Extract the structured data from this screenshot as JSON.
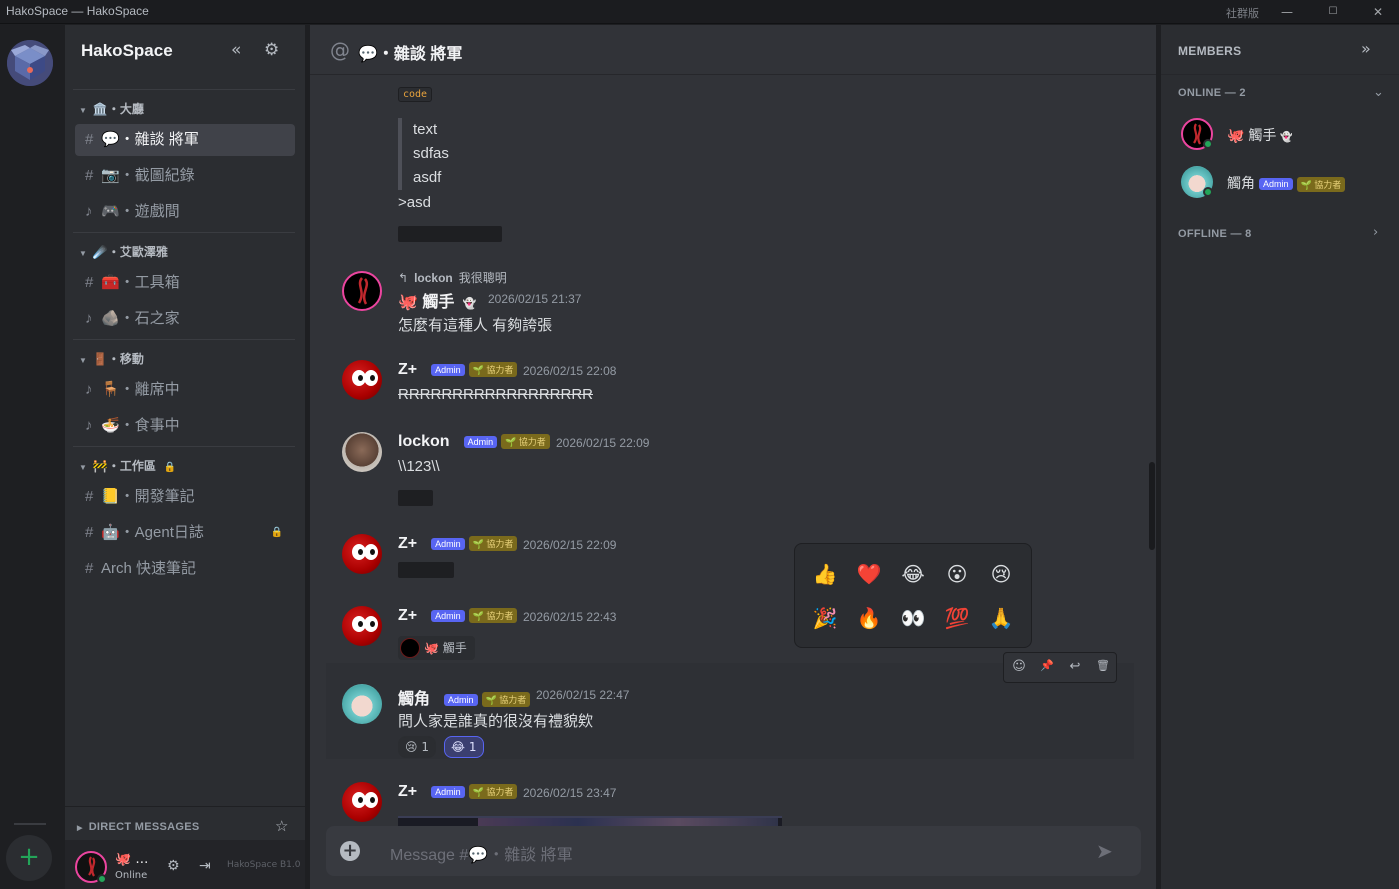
{
  "window": {
    "title": "HakoSpace — HakoSpace",
    "edition": "社群版",
    "min": "—",
    "max": "☐",
    "close": "✕"
  },
  "server": {
    "name": "HakoSpace",
    "add_label": "+"
  },
  "sidebar": {
    "categories": [
      {
        "label": "🏛️・大廳"
      },
      {
        "label": "☄️・艾歐澤雅"
      },
      {
        "label": "🚪・移動"
      },
      {
        "label": "🚧・工作區"
      }
    ],
    "channels": [
      {
        "prefix": "#",
        "label": "💬・雜談 將軍"
      },
      {
        "prefix": "#",
        "label": "📷・截圖紀錄"
      },
      {
        "prefix": "♪",
        "label": "🎮・遊戲間"
      },
      {
        "prefix": "#",
        "label": "🧰・工具箱"
      },
      {
        "prefix": "♪",
        "label": "🪨・石之家"
      },
      {
        "prefix": "♪",
        "label": "🪑・離席中"
      },
      {
        "prefix": "♪",
        "label": "🍜・食事中"
      },
      {
        "prefix": "#",
        "label": "📒・開發筆記"
      },
      {
        "prefix": "#",
        "label": "🤖・Agent日誌"
      },
      {
        "prefix": "#",
        "label": "Arch 快速筆記"
      }
    ],
    "dm_label": "DIRECT MESSAGES",
    "user": {
      "name": "🐙 …",
      "status": "Online",
      "version": "HakoSpace B1.0"
    }
  },
  "channel": {
    "at": "@",
    "title": "💬・雜談 將軍"
  },
  "messages": {
    "code_chip": "code",
    "quote_lines": [
      "text",
      "sdfas",
      "asdf"
    ],
    "gt_line": ">asd",
    "m1": {
      "reply_user": "lockon",
      "reply_text": "我很聰明",
      "author": "🐙 觸手",
      "ghost": "👻",
      "ts": "2026/02/15 21:37",
      "text": "怎麼有這種人 有夠誇張"
    },
    "m2": {
      "author": "Z+",
      "admin": "Admin",
      "contrib": "🌱 協力者",
      "ts": "2026/02/15 22:08",
      "text": "RRRRRRRRRRRRRRRRRR"
    },
    "m3": {
      "author": "lockon",
      "admin": "Admin",
      "contrib": "🌱 協力者",
      "ts": "2026/02/15 22:09",
      "text": "\\\\123\\\\"
    },
    "m4": {
      "author": "Z+",
      "admin": "Admin",
      "contrib": "🌱 協力者",
      "ts": "2026/02/15 22:09"
    },
    "m5": {
      "author": "Z+",
      "admin": "Admin",
      "contrib": "🌱 協力者",
      "ts": "2026/02/15 22:43",
      "mention": "🐙 觸手"
    },
    "m6": {
      "author": "觸角",
      "admin": "Admin",
      "contrib": "🌱 協力者",
      "ts": "2026/02/15 22:47",
      "text": "問人家是誰真的很沒有禮貌欸",
      "reactions": [
        {
          "emoji": "😢",
          "count": "1"
        },
        {
          "emoji": "😂",
          "count": "1"
        }
      ]
    },
    "m7": {
      "author": "Z+",
      "admin": "Admin",
      "contrib": "🌱 協力者",
      "ts": "2026/02/15 23:47"
    }
  },
  "picker": {
    "emojis": [
      "👍",
      "❤️",
      "😂",
      "😮",
      "😢",
      "🎉",
      "🔥",
      "👀",
      "💯",
      "🙏"
    ]
  },
  "toolbar": {
    "react": "☺",
    "pin": "📌",
    "reply": "↩",
    "delete": "🗑"
  },
  "composer": {
    "placeholder": "Message #💬・雜談 將軍",
    "send": "➤"
  },
  "members": {
    "title": "MEMBERS",
    "online_label": "ONLINE — 2",
    "offline_label": "OFFLINE — 8",
    "online": [
      {
        "name": "🐙 觸手",
        "ghost": "👻"
      },
      {
        "name": "觸角",
        "admin": "Admin",
        "contrib": "🌱 協力者"
      }
    ]
  },
  "colors": {
    "accent": "#5865f2",
    "online": "#23a559",
    "pink": "#eb459f"
  }
}
